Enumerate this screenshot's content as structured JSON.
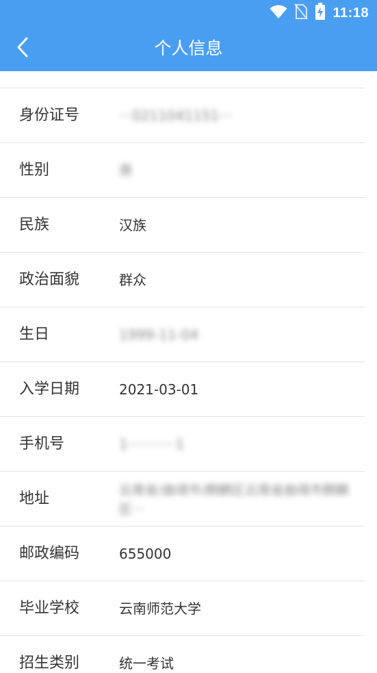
{
  "status_bar": {
    "time": "11:18",
    "icons": [
      "wifi-icon",
      "no-sim-icon",
      "battery-charging-icon"
    ]
  },
  "nav": {
    "back_icon": "chevron-left-icon",
    "title": "个人信息"
  },
  "colors": {
    "header": "#4a9ef2",
    "divider": "#e2e2e2",
    "text": "#333333"
  },
  "rows": [
    {
      "label": "身份证号",
      "value": "···0211041151···"
    },
    {
      "label": "性别",
      "value": "男"
    },
    {
      "label": "民族",
      "value": "汉族"
    },
    {
      "label": "政治面貌",
      "value": "群众"
    },
    {
      "label": "生日",
      "value": "1999-11-04"
    },
    {
      "label": "入学日期",
      "value": "2021-03-01"
    },
    {
      "label": "手机号",
      "value": "1···········1"
    },
    {
      "label": "地址",
      "value": "云南省/曲靖市/麒麟区云南省曲靖市麒麟区···"
    },
    {
      "label": "邮政编码",
      "value": "655000"
    },
    {
      "label": "毕业学校",
      "value": "云南师范大学"
    },
    {
      "label": "招生类别",
      "value": "统一考试"
    }
  ]
}
